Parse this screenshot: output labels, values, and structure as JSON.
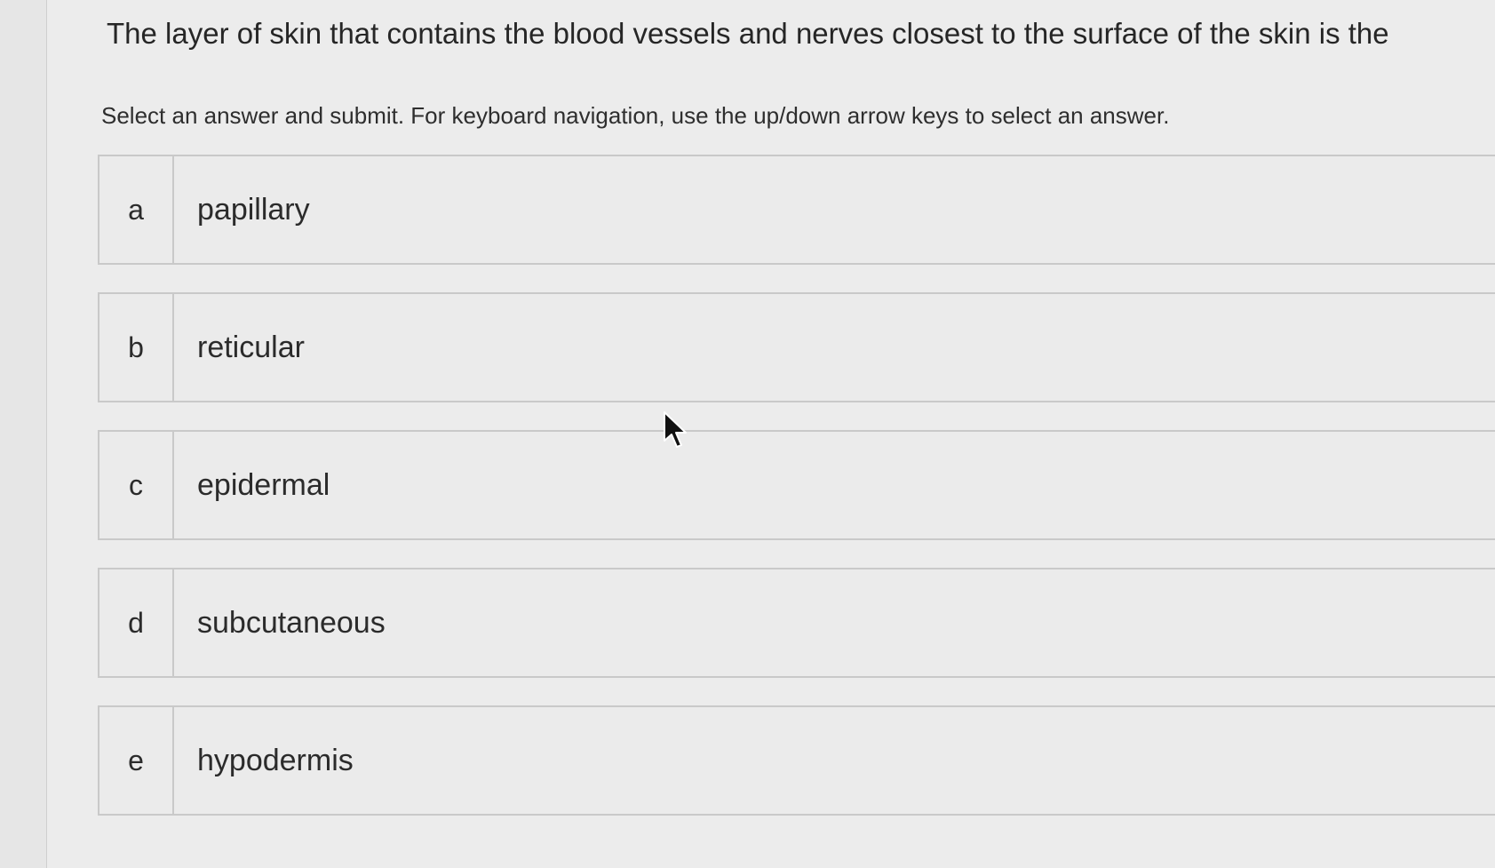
{
  "question": {
    "text": "The layer of skin that contains the blood vessels and nerves closest to the surface of the skin is the"
  },
  "instructions": {
    "text": "Select an answer and submit. For keyboard navigation, use the up/down arrow keys to select an answer."
  },
  "options": [
    {
      "letter": "a",
      "label": "papillary"
    },
    {
      "letter": "b",
      "label": "reticular"
    },
    {
      "letter": "c",
      "label": "epidermal"
    },
    {
      "letter": "d",
      "label": "subcutaneous"
    },
    {
      "letter": "e",
      "label": "hypodermis"
    }
  ],
  "colors": {
    "page_background": "#ececec",
    "option_border": "#c9c9c9",
    "text": "#2b2b2b"
  },
  "icons": {
    "cursor": "mouse-pointer-icon"
  }
}
